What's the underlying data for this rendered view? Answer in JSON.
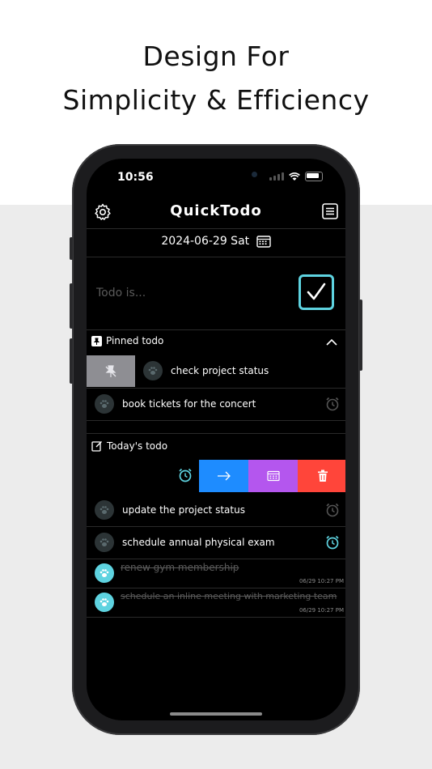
{
  "headline": {
    "line1": "Design For",
    "line2": "Simplicity & Efficiency"
  },
  "status_bar": {
    "time": "10:56"
  },
  "app": {
    "title": "QuickTodo",
    "date": "2024-06-29 Sat"
  },
  "input": {
    "placeholder": "Todo is..."
  },
  "pinned": {
    "header": "Pinned todo",
    "items": [
      {
        "text": "check project status"
      },
      {
        "text": "book tickets for the concert"
      }
    ]
  },
  "today": {
    "header": "Today's todo",
    "items": [
      {
        "text": "update the project status"
      },
      {
        "text": "schedule annual physical exam"
      },
      {
        "text": "renew gym membership",
        "done_time": "06/29 10:27 PM"
      },
      {
        "text": "schedule an inline meeting with marketing team",
        "done_time": "06/29 10:27 PM"
      }
    ]
  },
  "colors": {
    "accent": "#5ed3e0",
    "move": "#1e8cff",
    "schedule": "#b456ee",
    "delete": "#ff453a",
    "unpin": "#8e8e93"
  },
  "icons": [
    "gear-icon",
    "list-icon",
    "calendar-icon",
    "check-icon",
    "pin-icon",
    "chevron-up-icon",
    "unpin-icon",
    "paw-icon",
    "alarm-icon",
    "edit-icon",
    "arrow-right-icon",
    "trash-icon"
  ]
}
